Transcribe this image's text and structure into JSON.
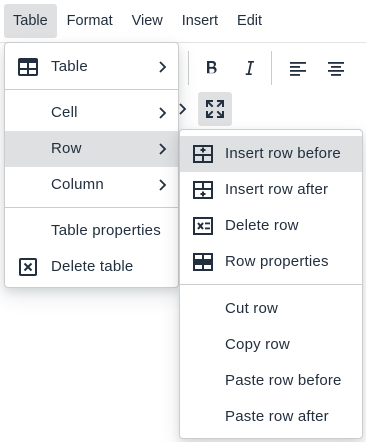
{
  "menubar": {
    "items": [
      "Table",
      "Format",
      "View",
      "Insert",
      "Edit"
    ]
  },
  "table_menu": {
    "table": "Table",
    "cell": "Cell",
    "row": "Row",
    "column": "Column",
    "table_properties": "Table properties",
    "delete_table": "Delete table"
  },
  "row_menu": {
    "insert_row_before": "Insert row before",
    "insert_row_after": "Insert row after",
    "delete_row": "Delete row",
    "row_properties": "Row properties",
    "cut_row": "Cut row",
    "copy_row": "Copy row",
    "paste_row_before": "Paste row before",
    "paste_row_after": "Paste row after"
  }
}
